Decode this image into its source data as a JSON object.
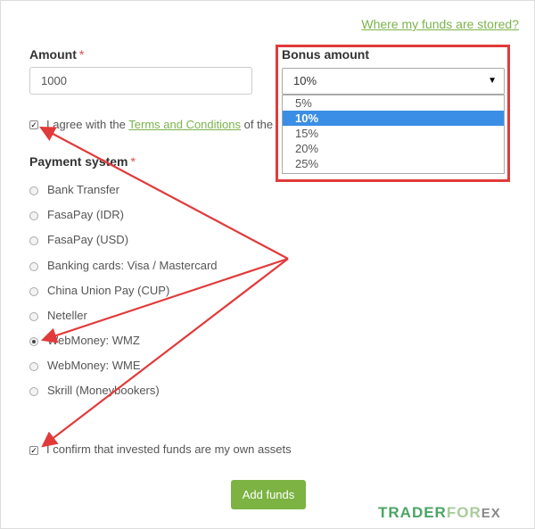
{
  "top_link": "Where my funds are stored?",
  "amount": {
    "label": "Amount",
    "required": "*",
    "value": "1000"
  },
  "bonus": {
    "label": "Bonus amount",
    "selected": "10%",
    "options": [
      "5%",
      "10%",
      "15%",
      "20%",
      "25%"
    ],
    "selected_index": 1
  },
  "agree": {
    "checked": true,
    "prefix": "I agree with the ",
    "link": "Terms and Conditions",
    "suffix": " of the"
  },
  "payment": {
    "label": "Payment system",
    "required": "*",
    "options": [
      "Bank Transfer",
      "FasaPay (IDR)",
      "FasaPay (USD)",
      "Banking cards: Visa / Mastercard",
      "China Union Pay (CUP)",
      "Neteller",
      "WebMoney: WMZ",
      "WebMoney: WME",
      "Skrill (Moneybookers)"
    ],
    "selected_index": 6
  },
  "confirm": {
    "checked": true,
    "text": "I confirm that invested funds are my own assets"
  },
  "submit_label": "Add funds",
  "watermark": {
    "part1": "TRADER",
    "part2": "FOR",
    "part3": "EX"
  },
  "colors": {
    "accent": "#7cb342",
    "annotation": "#e23a3a",
    "select_highlight": "#3b8ee5"
  }
}
